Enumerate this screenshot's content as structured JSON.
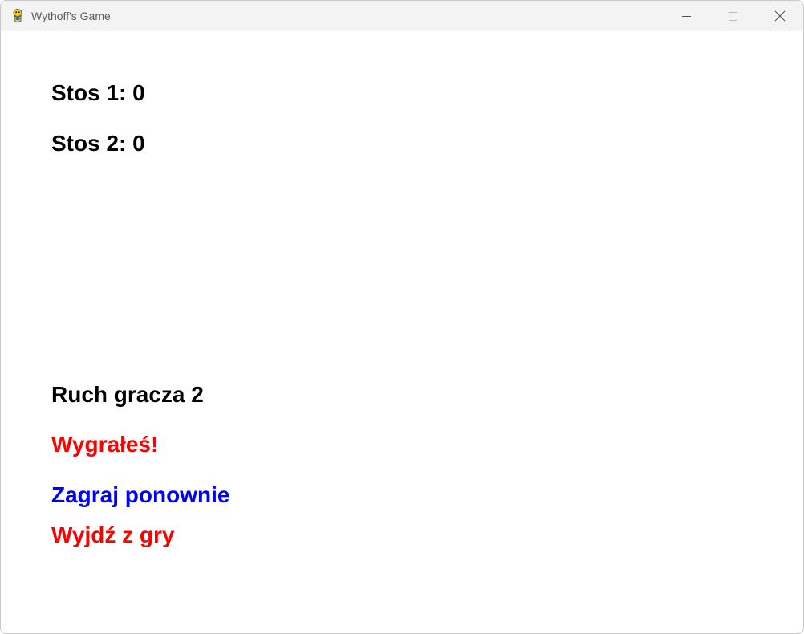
{
  "window": {
    "title": "Wythoff's Game",
    "icon": "pygame-snake-icon"
  },
  "titlebar_controls": {
    "minimize": "minimize-icon",
    "maximize": "maximize-icon",
    "close": "close-icon"
  },
  "game": {
    "pile1": "Stos 1: 0",
    "pile2": "Stos 2: 0",
    "turn": "Ruch gracza 2",
    "result": "Wygrałeś!",
    "play_again": "Zagraj ponownie",
    "quit": "Wyjdź z gry"
  },
  "colors": {
    "text": "#000000",
    "result": "#ff0000",
    "play_again": "#0000ff",
    "quit": "#ff0000"
  }
}
